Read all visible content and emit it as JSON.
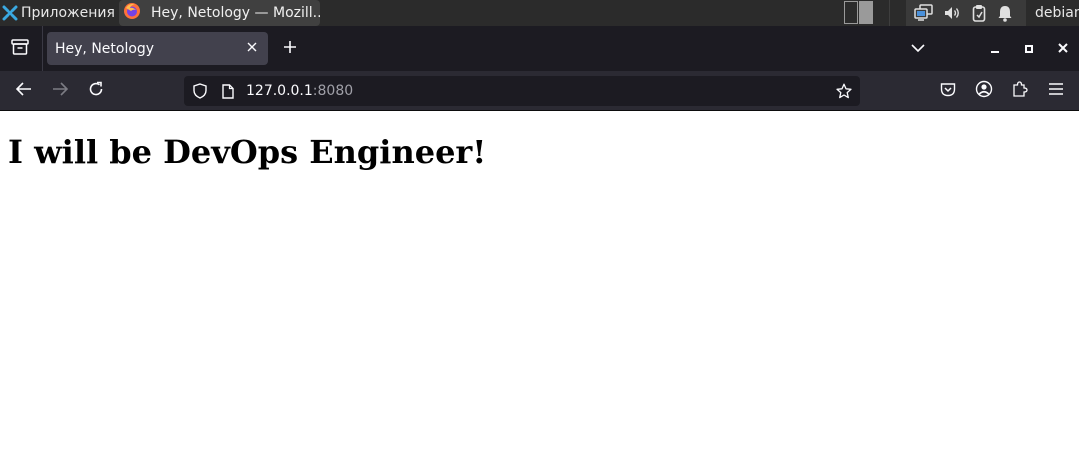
{
  "panel": {
    "apps_menu_label": "Приложения",
    "apps_menu_separator": "⁝",
    "task_title": "Hey, Netology — Mozill...",
    "username": "debian",
    "tray_icons": [
      "network-icon",
      "volume-icon",
      "clipboard-icon",
      "notification-bell-icon"
    ]
  },
  "browser": {
    "tab": {
      "title": "Hey, Netology"
    },
    "url": {
      "host": "127.0.0.1",
      "port": ":8080"
    },
    "colors": {
      "tabstrip": "#1c1b22",
      "toolbar": "#2b2a33",
      "active_tab": "#42414d",
      "urlbar": "#1c1b22"
    }
  },
  "page": {
    "heading": "I will be DevOps Engineer!"
  }
}
